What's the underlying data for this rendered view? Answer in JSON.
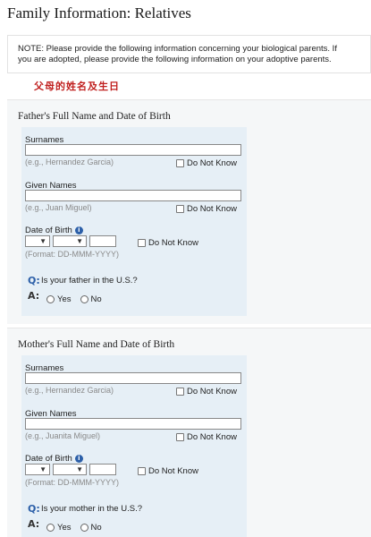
{
  "page": {
    "title": "Family Information: Relatives"
  },
  "note": {
    "line1": "NOTE: Please provide the following information concerning your biological parents. If",
    "line2": "you are adopted, please provide the following information on your adoptive parents."
  },
  "chinese_label": "父母的姓名及生日",
  "father": {
    "heading": "Father's Full Name and Date of Birth",
    "surnames_label": "Surnames",
    "surnames_value": "",
    "surnames_hint": "(e.g., Hernandez Garcia)",
    "given_label": "Given Names",
    "given_value": "",
    "given_hint": "(e.g., Juan Miguel)",
    "dob_label": "Date of Birth",
    "dob_hint": "(Format: DD-MMM-YYYY)",
    "do_not_know": "Do Not Know",
    "question": "Is your father in the U.S.?",
    "q": "Q:",
    "a": "A:",
    "yes": "Yes",
    "no": "No"
  },
  "mother": {
    "heading": "Mother's Full Name and Date of Birth",
    "surnames_label": "Surnames",
    "surnames_value": "",
    "surnames_hint": "(e.g., Hernandez Garcia)",
    "given_label": "Given Names",
    "given_value": "",
    "given_hint": "(e.g., Juanita Miguel)",
    "dob_label": "Date of Birth",
    "dob_hint": "(Format: DD-MMM-YYYY)",
    "do_not_know": "Do Not Know",
    "question": "Is your mother in the U.S.?",
    "q": "Q:",
    "a": "A:",
    "yes": "Yes",
    "no": "No"
  },
  "icons": {
    "info": "info-icon",
    "dropdown": "chevron-down-icon"
  },
  "colors": {
    "accent": "#2c5fa8",
    "chinese_text": "#c0201f",
    "panel": "#e6eff6",
    "section_bg": "#f5f7f8"
  }
}
